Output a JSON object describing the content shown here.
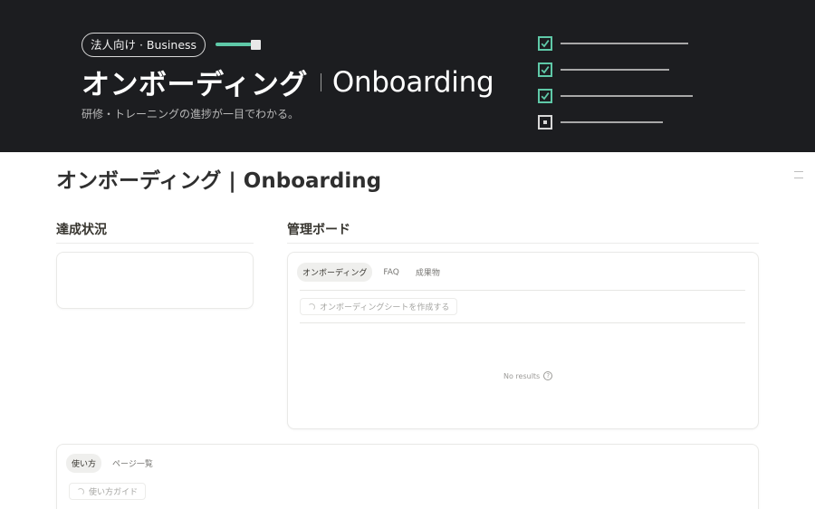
{
  "cover": {
    "badge": "法人向け · Business",
    "progress": 0.83,
    "title_ja": "オンボーディング",
    "title_en": "Onboarding",
    "subtitle": "研修・トレーニングの進捗が一目でわかる。",
    "checklist": [
      {
        "checked": true
      },
      {
        "checked": true
      },
      {
        "checked": true
      },
      {
        "checked": false
      }
    ],
    "accent_color": "#5fc9a8",
    "background_color": "#1c1d20"
  },
  "page": {
    "title": "オンボーディング | Onboarding",
    "menu_icon": "collapse-icon"
  },
  "progress_section": {
    "heading": "達成状況"
  },
  "board_section": {
    "heading": "管理ボード",
    "tabs": [
      "オンボーディング",
      "FAQ",
      "成果物"
    ],
    "active_tab": "オンボーディング",
    "new_button": "オンボーディングシートを作成する",
    "empty_text": "No results",
    "empty_icon": "help-circle-icon"
  },
  "guide_section": {
    "tabs": [
      "使い方",
      "ページ一覧"
    ],
    "active_tab": "使い方",
    "new_button": "使い方ガイド"
  }
}
